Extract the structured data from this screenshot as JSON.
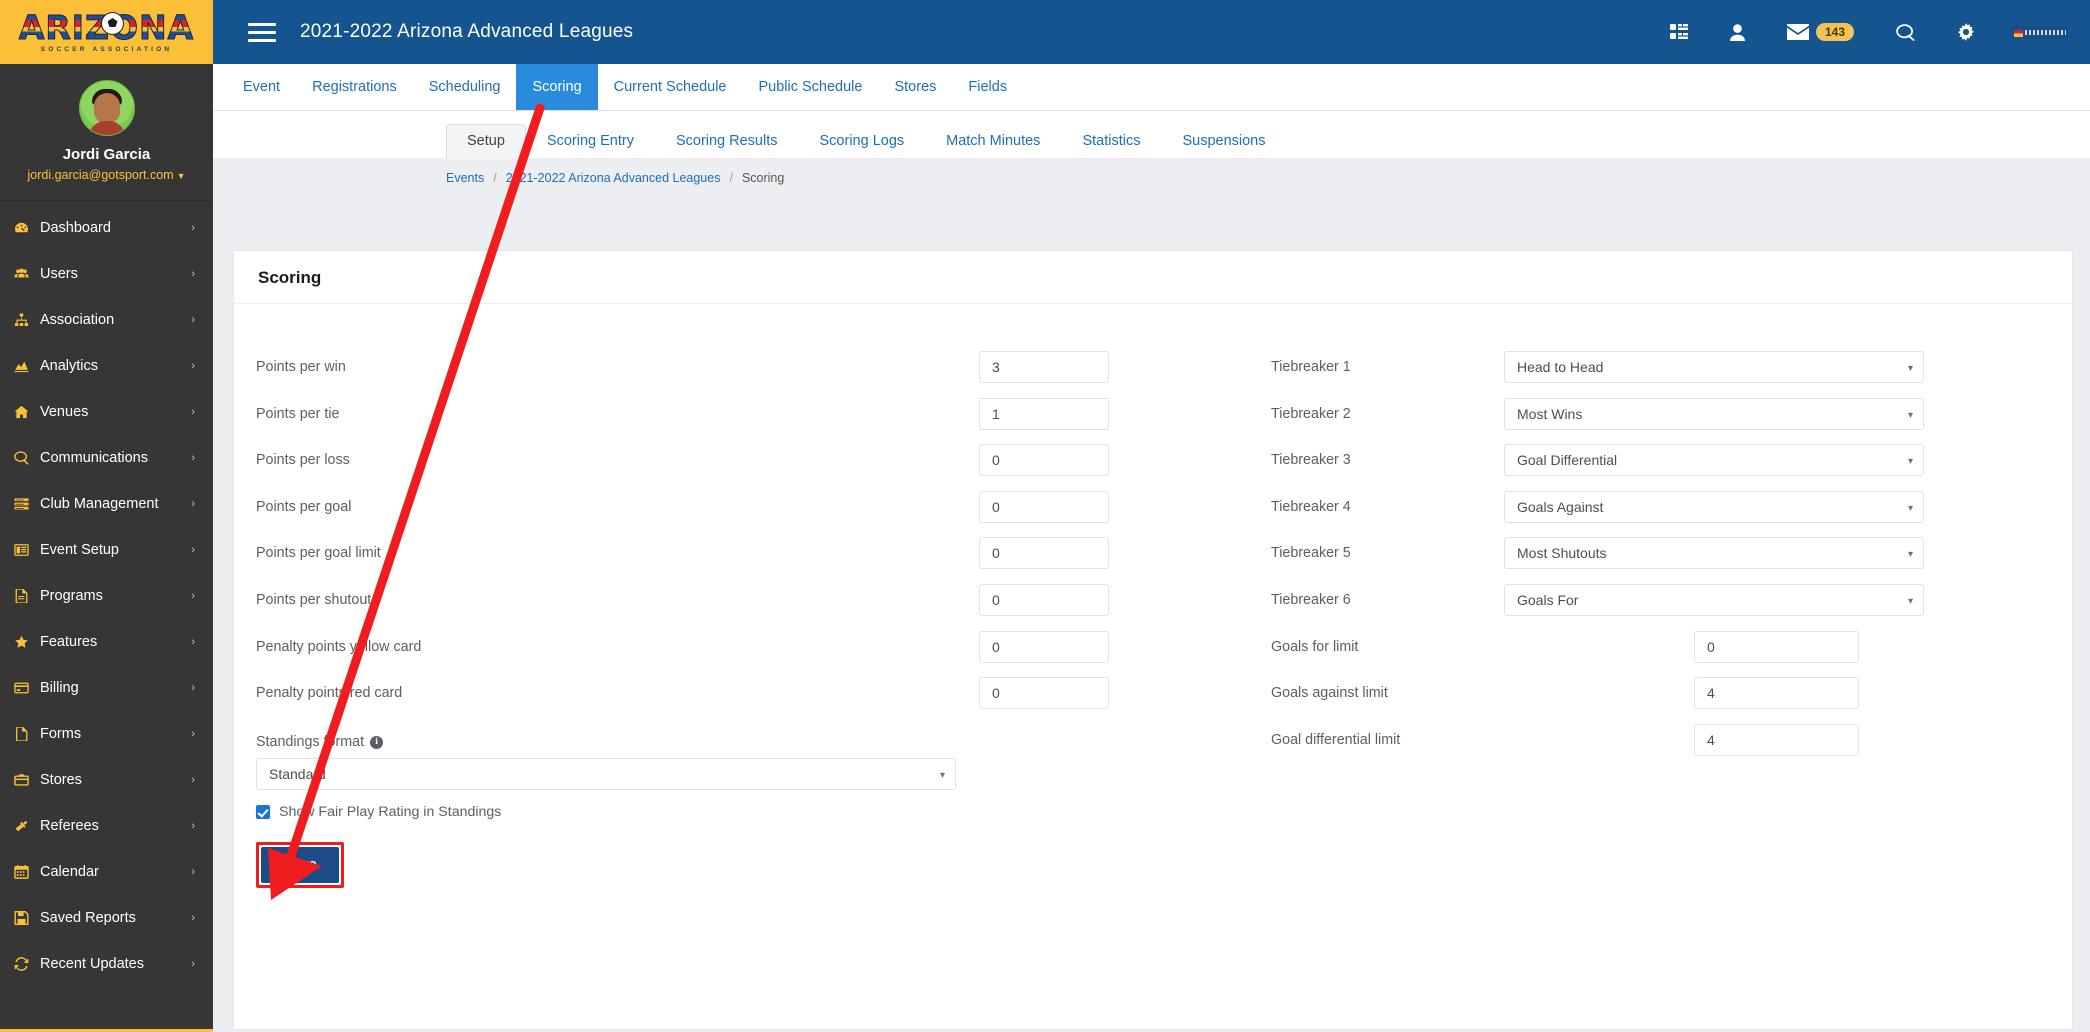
{
  "brand": {
    "logo_text": "ARIZONA",
    "logo_subtext": "SOCCER ASSOCIATION"
  },
  "profile": {
    "name": "Jordi Garcia",
    "email": "jordi.garcia@gotsport.com",
    "caret": "▼"
  },
  "sidebar": {
    "items": [
      {
        "label": "Dashboard",
        "icon": "dashboard-icon",
        "chevron": "›"
      },
      {
        "label": "Users",
        "icon": "users-icon",
        "chevron": "›"
      },
      {
        "label": "Association",
        "icon": "sitemap-icon",
        "chevron": "›"
      },
      {
        "label": "Analytics",
        "icon": "chart-area-icon",
        "chevron": "›"
      },
      {
        "label": "Venues",
        "icon": "home-icon",
        "chevron": "›"
      },
      {
        "label": "Communications",
        "icon": "comment-icon",
        "chevron": "›"
      },
      {
        "label": "Club Management",
        "icon": "list-icon",
        "chevron": "›"
      },
      {
        "label": "Event Setup",
        "icon": "window-icon",
        "chevron": "›"
      },
      {
        "label": "Programs",
        "icon": "file-text-icon",
        "chevron": "›"
      },
      {
        "label": "Features",
        "icon": "star-icon",
        "chevron": "›"
      },
      {
        "label": "Billing",
        "icon": "credit-card-icon",
        "chevron": "›"
      },
      {
        "label": "Forms",
        "icon": "file-icon",
        "chevron": "›"
      },
      {
        "label": "Stores",
        "icon": "briefcase-icon",
        "chevron": "›"
      },
      {
        "label": "Referees",
        "icon": "gavel-icon",
        "chevron": "›"
      },
      {
        "label": "Calendar",
        "icon": "calendar-icon",
        "chevron": "›"
      },
      {
        "label": "Saved Reports",
        "icon": "save-icon",
        "chevron": "›"
      },
      {
        "label": "Recent Updates",
        "icon": "refresh-icon",
        "chevron": "›"
      }
    ]
  },
  "header": {
    "title": "2021-2022 Arizona Advanced Leagues",
    "menu_icon": "hamburger-icon",
    "icons": [
      {
        "name": "grid-icon"
      },
      {
        "name": "user-icon"
      },
      {
        "name": "mail-icon",
        "badge": "143"
      },
      {
        "name": "chat-icon"
      },
      {
        "name": "gear-icon"
      },
      {
        "name": "arizona-logo-icon"
      }
    ]
  },
  "main_nav": {
    "tabs": [
      {
        "label": "Event",
        "active": false
      },
      {
        "label": "Registrations",
        "active": false
      },
      {
        "label": "Scheduling",
        "active": false
      },
      {
        "label": "Scoring",
        "active": true
      },
      {
        "label": "Current Schedule",
        "active": false
      },
      {
        "label": "Public Schedule",
        "active": false
      },
      {
        "label": "Stores",
        "active": false
      },
      {
        "label": "Fields",
        "active": false
      }
    ]
  },
  "sub_nav": {
    "tabs": [
      {
        "label": "Setup",
        "active": true
      },
      {
        "label": "Scoring Entry",
        "active": false
      },
      {
        "label": "Scoring Results",
        "active": false
      },
      {
        "label": "Scoring Logs",
        "active": false
      },
      {
        "label": "Match Minutes",
        "active": false
      },
      {
        "label": "Statistics",
        "active": false
      },
      {
        "label": "Suspensions",
        "active": false
      }
    ]
  },
  "breadcrumb": {
    "items": [
      "Events",
      "2021-2022 Arizona Advanced Leagues",
      "Scoring"
    ],
    "separator": "/"
  },
  "card": {
    "title": "Scoring",
    "left_fields": [
      {
        "label": "Points per win",
        "value": "3"
      },
      {
        "label": "Points per tie",
        "value": "1"
      },
      {
        "label": "Points per loss",
        "value": "0"
      },
      {
        "label": "Points per goal",
        "value": "0"
      },
      {
        "label": "Points per goal limit",
        "value": "0"
      },
      {
        "label": "Points per shutout",
        "value": "0"
      },
      {
        "label": "Penalty points yellow card",
        "value": "0"
      },
      {
        "label": "Penalty points red card",
        "value": "0"
      }
    ],
    "tiebreakers": [
      {
        "label": "Tiebreaker 1",
        "value": "Head to Head"
      },
      {
        "label": "Tiebreaker 2",
        "value": "Most Wins"
      },
      {
        "label": "Tiebreaker 3",
        "value": "Goal Differential"
      },
      {
        "label": "Tiebreaker 4",
        "value": "Goals Against"
      },
      {
        "label": "Tiebreaker 5",
        "value": "Most Shutouts"
      },
      {
        "label": "Tiebreaker 6",
        "value": "Goals For"
      }
    ],
    "right_fields": [
      {
        "label": "Goals for limit",
        "value": "0"
      },
      {
        "label": "Goals against limit",
        "value": "4"
      },
      {
        "label": "Goal differential limit",
        "value": "4"
      }
    ],
    "standings": {
      "label": "Standings format",
      "info_icon": "info-icon",
      "value": "Standard"
    },
    "fair_play": {
      "label": "Show Fair Play Rating in Standings",
      "checked": true
    },
    "save_label": "Save"
  },
  "annotation": {
    "arrow_color": "#ef1d1d",
    "highlight_color": "#ef1d1d"
  },
  "colors": {
    "brand_yellow": "#fbc037",
    "header_blue": "#14558f",
    "link_blue": "#1d6fb8",
    "active_tab_blue": "#2a8bdd",
    "save_blue": "#1b4c88",
    "sidebar_dark": "#363636",
    "page_bg": "#eceef1"
  }
}
